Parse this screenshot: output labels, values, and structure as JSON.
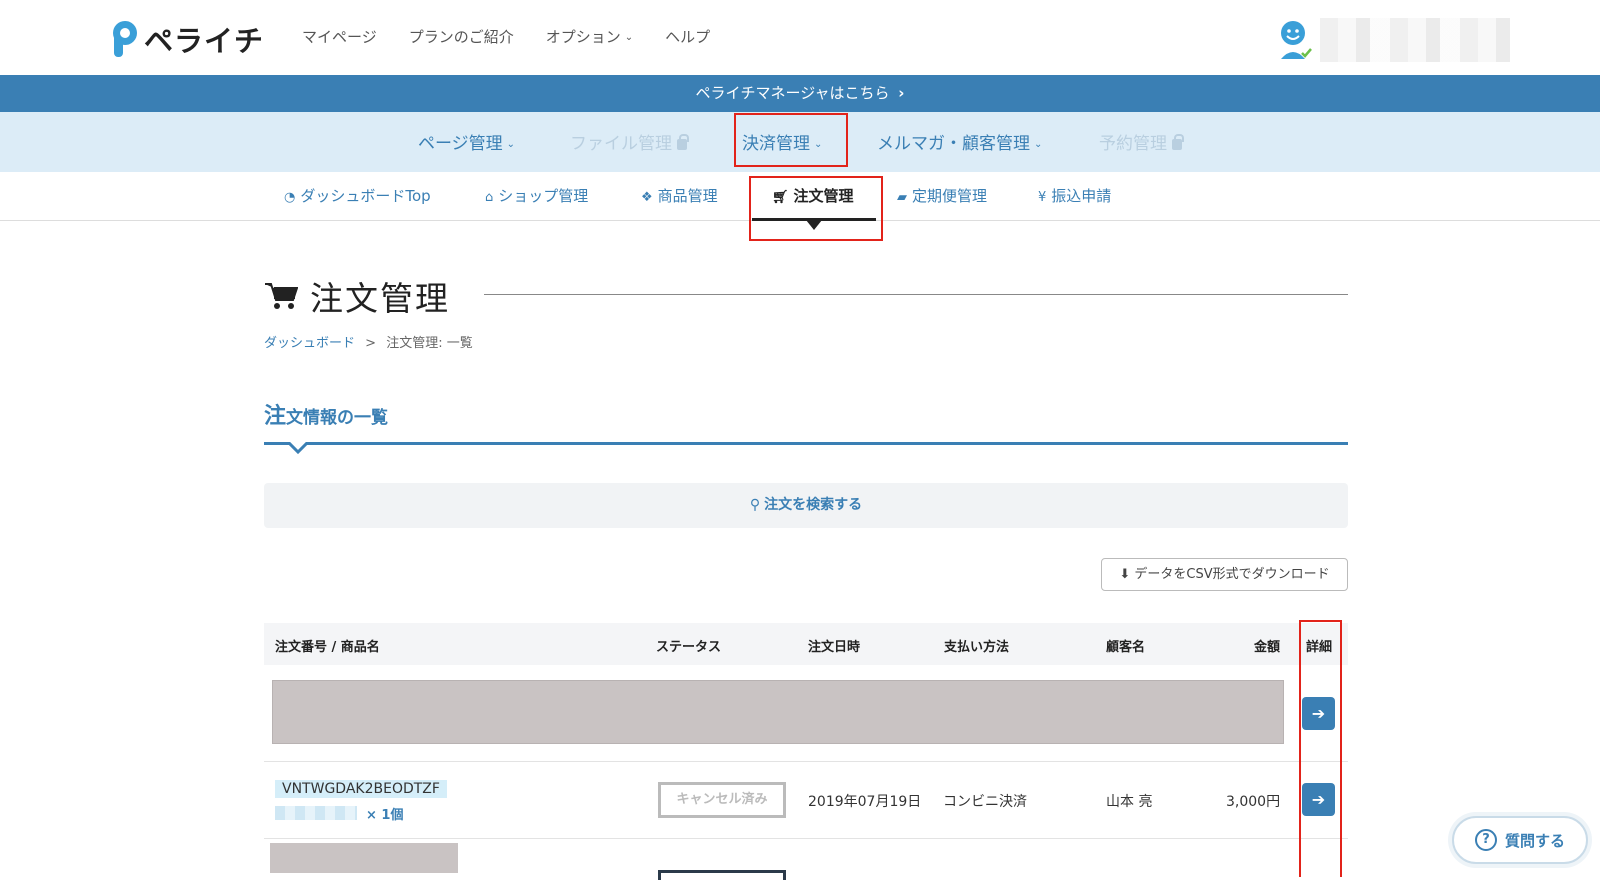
{
  "header": {
    "logo_text": "ペライチ",
    "nav": [
      {
        "label": "マイページ"
      },
      {
        "label": "プランのご紹介"
      },
      {
        "label": "オプション"
      },
      {
        "label": "ヘルプ"
      }
    ]
  },
  "banner": {
    "label": "ペライチマネージャはこちら"
  },
  "main_nav": [
    {
      "label": "ページ管理",
      "state": "enabled"
    },
    {
      "label": "ファイル管理",
      "state": "locked"
    },
    {
      "label": "決済管理",
      "state": "selected"
    },
    {
      "label": "メルマガ・顧客管理",
      "state": "enabled"
    },
    {
      "label": "予約管理",
      "state": "locked"
    }
  ],
  "sub_nav": [
    {
      "label": "ダッシュボードTop",
      "icon": "dashboard-icon"
    },
    {
      "label": "ショップ管理",
      "icon": "home-icon"
    },
    {
      "label": "商品管理",
      "icon": "cubes-icon"
    },
    {
      "label": "注文管理",
      "icon": "cart-icon",
      "active": true
    },
    {
      "label": "定期便管理",
      "icon": "truck-icon"
    },
    {
      "label": "振込申請",
      "icon": "yen-icon"
    }
  ],
  "page": {
    "title": "注文管理",
    "breadcrumb_link": "ダッシュボード",
    "breadcrumb_sep": ">",
    "breadcrumb_current": "注文管理: 一覧"
  },
  "section": {
    "title_first": "注",
    "title_rest": "文情報の一覧"
  },
  "search": {
    "label": "注文を検索する"
  },
  "csv_button": {
    "label": "データをCSV形式でダウンロード"
  },
  "table": {
    "headers": [
      "注文番号 / 商品名",
      "ステータス",
      "注文日時",
      "支払い方法",
      "顧客名",
      "金額",
      "詳細"
    ],
    "rows": [
      {
        "order_id": "VNTWGDAK2BEODTZF",
        "quantity": "× 1個",
        "status": "キャンセル済み",
        "date": "2019年07月19日",
        "payment": "コンビニ決済",
        "customer": "山本 亮",
        "amount": "3,000円"
      }
    ]
  },
  "help": {
    "question_label": "質問する"
  },
  "colors": {
    "accent": "#3a7fb4",
    "highlight": "#e2231a",
    "nav_bg": "#dcecf7"
  }
}
